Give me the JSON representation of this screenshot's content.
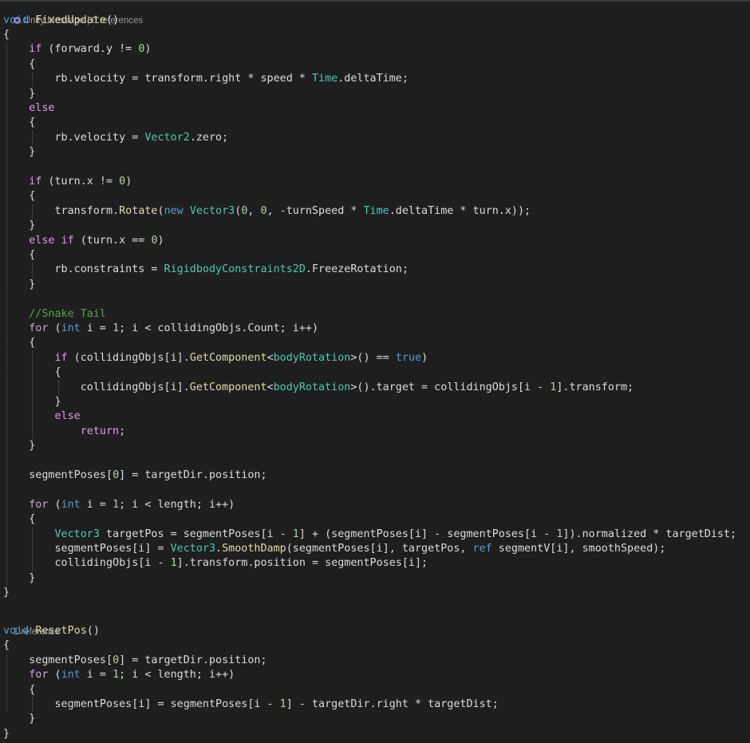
{
  "code_lens": {
    "unity_message": "Unity Message",
    "separator": " | ",
    "fixed_update_refs": "0 references",
    "reset_pos_refs": "1 reference"
  },
  "colors": {
    "background": "#1e1e1e",
    "keyword": "#569cd6",
    "control": "#d8a0df",
    "type": "#4ec9b0",
    "method": "#dcdcaa",
    "number": "#b5cea8",
    "comment": "#57a64a",
    "text": "#dcdcdc"
  },
  "code": {
    "lines": [
      [
        [
          "kw",
          "void"
        ],
        [
          "pl",
          " "
        ],
        [
          "fn",
          "FixedUpdate"
        ],
        [
          "pl",
          "()"
        ]
      ],
      [
        [
          "pl",
          "{"
        ]
      ],
      [
        [
          "pl",
          "    "
        ],
        [
          "ctl",
          "if"
        ],
        [
          "pl",
          " (forward.y != "
        ],
        [
          "num",
          "0"
        ],
        [
          "pl",
          ")"
        ]
      ],
      [
        [
          "pl",
          "    {"
        ]
      ],
      [
        [
          "pl",
          "        rb.velocity = transform.right * speed * "
        ],
        [
          "ty",
          "Time"
        ],
        [
          "pl",
          ".deltaTime;"
        ]
      ],
      [
        [
          "pl",
          "    }"
        ]
      ],
      [
        [
          "pl",
          "    "
        ],
        [
          "ctl",
          "else"
        ]
      ],
      [
        [
          "pl",
          "    {"
        ]
      ],
      [
        [
          "pl",
          "        rb.velocity = "
        ],
        [
          "ty",
          "Vector2"
        ],
        [
          "pl",
          ".zero;"
        ]
      ],
      [
        [
          "pl",
          "    }"
        ]
      ],
      [
        [
          "pl",
          ""
        ]
      ],
      [
        [
          "pl",
          "    "
        ],
        [
          "ctl",
          "if"
        ],
        [
          "pl",
          " (turn.x != "
        ],
        [
          "num",
          "0"
        ],
        [
          "pl",
          ")"
        ]
      ],
      [
        [
          "pl",
          "    {"
        ]
      ],
      [
        [
          "pl",
          "        transform."
        ],
        [
          "fn",
          "Rotate"
        ],
        [
          "pl",
          "("
        ],
        [
          "kw",
          "new"
        ],
        [
          "pl",
          " "
        ],
        [
          "ty",
          "Vector3"
        ],
        [
          "pl",
          "("
        ],
        [
          "num",
          "0"
        ],
        [
          "pl",
          ", "
        ],
        [
          "num",
          "0"
        ],
        [
          "pl",
          ", -turnSpeed * "
        ],
        [
          "ty",
          "Time"
        ],
        [
          "pl",
          ".deltaTime * turn.x));"
        ]
      ],
      [
        [
          "pl",
          "    }"
        ]
      ],
      [
        [
          "pl",
          "    "
        ],
        [
          "ctl",
          "else"
        ],
        [
          "pl",
          " "
        ],
        [
          "ctl",
          "if"
        ],
        [
          "pl",
          " (turn.x == "
        ],
        [
          "num",
          "0"
        ],
        [
          "pl",
          ")"
        ]
      ],
      [
        [
          "pl",
          "    {"
        ]
      ],
      [
        [
          "pl",
          "        rb.constraints = "
        ],
        [
          "ty",
          "RigidbodyConstraints2D"
        ],
        [
          "pl",
          ".FreezeRotation;"
        ]
      ],
      [
        [
          "pl",
          "    }"
        ]
      ],
      [
        [
          "pl",
          ""
        ]
      ],
      [
        [
          "pl",
          "    "
        ],
        [
          "cm",
          "//Snake Tail"
        ]
      ],
      [
        [
          "pl",
          "    "
        ],
        [
          "ctl",
          "for"
        ],
        [
          "pl",
          " ("
        ],
        [
          "kw",
          "int"
        ],
        [
          "pl",
          " i = "
        ],
        [
          "num",
          "1"
        ],
        [
          "pl",
          "; i < collidingObjs.Count; i++)"
        ]
      ],
      [
        [
          "pl",
          "    {"
        ]
      ],
      [
        [
          "pl",
          "        "
        ],
        [
          "ctl",
          "if"
        ],
        [
          "pl",
          " (collidingObjs[i]."
        ],
        [
          "fn",
          "GetComponent"
        ],
        [
          "pl",
          "<"
        ],
        [
          "ty",
          "bodyRotation"
        ],
        [
          "pl",
          ">() == "
        ],
        [
          "kw",
          "true"
        ],
        [
          "pl",
          ")"
        ]
      ],
      [
        [
          "pl",
          "        {"
        ]
      ],
      [
        [
          "pl",
          "            collidingObjs[i]."
        ],
        [
          "fn",
          "GetComponent"
        ],
        [
          "pl",
          "<"
        ],
        [
          "ty",
          "bodyRotation"
        ],
        [
          "pl",
          ">().target = collidingObjs[i - "
        ],
        [
          "num",
          "1"
        ],
        [
          "pl",
          "].transform;"
        ]
      ],
      [
        [
          "pl",
          "        }"
        ]
      ],
      [
        [
          "pl",
          "        "
        ],
        [
          "ctl",
          "else"
        ]
      ],
      [
        [
          "pl",
          "            "
        ],
        [
          "ctl",
          "return"
        ],
        [
          "pl",
          ";"
        ]
      ],
      [
        [
          "pl",
          "    }"
        ]
      ],
      [
        [
          "pl",
          ""
        ]
      ],
      [
        [
          "pl",
          "    segmentPoses["
        ],
        [
          "num",
          "0"
        ],
        [
          "pl",
          "] = targetDir.position;"
        ]
      ],
      [
        [
          "pl",
          ""
        ]
      ],
      [
        [
          "pl",
          "    "
        ],
        [
          "ctl",
          "for"
        ],
        [
          "pl",
          " ("
        ],
        [
          "kw",
          "int"
        ],
        [
          "pl",
          " i = "
        ],
        [
          "num",
          "1"
        ],
        [
          "pl",
          "; i < length; i++)"
        ]
      ],
      [
        [
          "pl",
          "    {"
        ]
      ],
      [
        [
          "pl",
          "        "
        ],
        [
          "ty",
          "Vector3"
        ],
        [
          "pl",
          " targetPos = segmentPoses[i - "
        ],
        [
          "num",
          "1"
        ],
        [
          "pl",
          "] + (segmentPoses[i] - segmentPoses[i - "
        ],
        [
          "num",
          "1"
        ],
        [
          "pl",
          "]).normalized * targetDist;"
        ]
      ],
      [
        [
          "pl",
          "        segmentPoses[i] = "
        ],
        [
          "ty",
          "Vector3"
        ],
        [
          "pl",
          "."
        ],
        [
          "fn",
          "SmoothDamp"
        ],
        [
          "pl",
          "(segmentPoses[i], targetPos, "
        ],
        [
          "kw",
          "ref"
        ],
        [
          "pl",
          " segmentV[i], smoothSpeed);"
        ]
      ],
      [
        [
          "pl",
          "        collidingObjs[i - "
        ],
        [
          "num",
          "1"
        ],
        [
          "pl",
          "].transform.position = segmentPoses[i];"
        ]
      ],
      [
        [
          "pl",
          "    }"
        ]
      ],
      [
        [
          "pl",
          "}"
        ]
      ],
      [
        [
          "pl",
          ""
        ]
      ],
      [
        [
          "kw",
          "void"
        ],
        [
          "pl",
          " "
        ],
        [
          "fn",
          "ResetPos"
        ],
        [
          "pl",
          "()"
        ]
      ],
      [
        [
          "pl",
          "{"
        ]
      ],
      [
        [
          "pl",
          "    segmentPoses["
        ],
        [
          "num",
          "0"
        ],
        [
          "pl",
          "] = targetDir.position;"
        ]
      ],
      [
        [
          "pl",
          "    "
        ],
        [
          "ctl",
          "for"
        ],
        [
          "pl",
          " ("
        ],
        [
          "kw",
          "int"
        ],
        [
          "pl",
          " i = "
        ],
        [
          "num",
          "1"
        ],
        [
          "pl",
          "; i < length; i++)"
        ]
      ],
      [
        [
          "pl",
          "    {"
        ]
      ],
      [
        [
          "pl",
          "        segmentPoses[i] = segmentPoses[i - "
        ],
        [
          "num",
          "1"
        ],
        [
          "pl",
          "] - targetDir.right * targetDist;"
        ]
      ],
      [
        [
          "pl",
          "    }"
        ]
      ],
      [
        [
          "pl",
          "}"
        ]
      ]
    ]
  }
}
